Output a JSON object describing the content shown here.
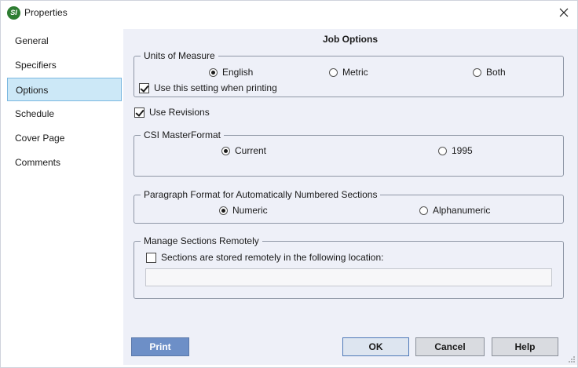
{
  "window": {
    "title": "Properties",
    "icon_text": "SI"
  },
  "sidebar": {
    "items": [
      {
        "label": "General"
      },
      {
        "label": "Specifiers"
      },
      {
        "label": "Options",
        "selected": true
      },
      {
        "label": "Schedule"
      },
      {
        "label": "Cover Page"
      },
      {
        "label": "Comments"
      }
    ]
  },
  "main": {
    "heading": "Job Options",
    "units": {
      "legend": "Units of Measure",
      "options": [
        "English",
        "Metric",
        "Both"
      ],
      "selected": "English",
      "use_when_printing": {
        "label": "Use this setting when printing",
        "checked": true
      }
    },
    "use_revisions": {
      "label": "Use Revisions",
      "checked": true
    },
    "csi": {
      "legend": "CSI MasterFormat",
      "options": [
        "Current",
        "1995"
      ],
      "selected": "Current"
    },
    "paragraph": {
      "legend": "Paragraph Format for Automatically Numbered Sections",
      "options": [
        "Numeric",
        "Alphanumeric"
      ],
      "selected": "Numeric"
    },
    "remote": {
      "legend": "Manage Sections Remotely",
      "stored_remotely": {
        "label": "Sections are stored remotely in the following location:",
        "checked": false
      },
      "location_value": ""
    }
  },
  "buttons": {
    "print": "Print",
    "ok": "OK",
    "cancel": "Cancel",
    "help": "Help"
  },
  "colors": {
    "accent": "#6d8fc7",
    "selection": "#cce8f7",
    "panel": "#eef0f8"
  }
}
